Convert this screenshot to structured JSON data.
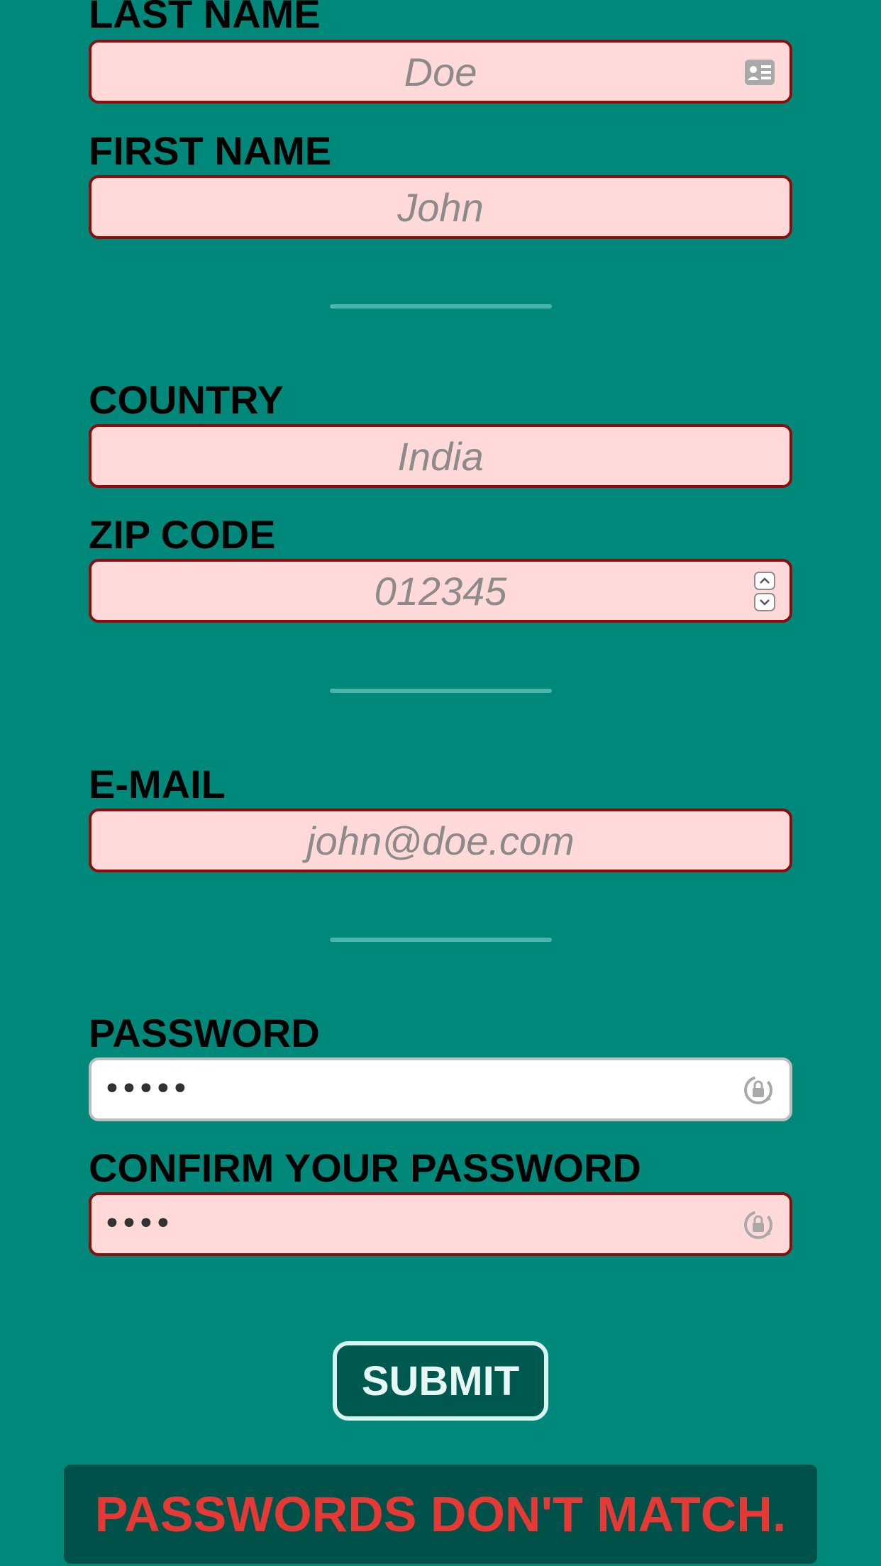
{
  "form": {
    "last_name": {
      "label": "LAST NAME",
      "placeholder": "Doe",
      "value": ""
    },
    "first_name": {
      "label": "FIRST NAME",
      "placeholder": "John",
      "value": ""
    },
    "country": {
      "label": "COUNTRY",
      "placeholder": "India",
      "value": ""
    },
    "zip": {
      "label": "ZIP CODE",
      "placeholder": "012345",
      "value": ""
    },
    "email": {
      "label": "E-MAIL",
      "placeholder": "john@doe.com",
      "value": ""
    },
    "password": {
      "label": "PASSWORD",
      "masked_value": "•••••"
    },
    "confirm_password": {
      "label": "CONFIRM YOUR PASSWORD",
      "masked_value": "••••"
    },
    "submit_label": "SUBMIT",
    "error_message": "PASSWORDS DON'T MATCH."
  },
  "icons": {
    "contact_card": "contact-card-icon",
    "stepper": "number-stepper-icon",
    "password_key": "password-key-icon"
  },
  "colors": {
    "background": "#00897b",
    "field_error_bg": "#ffdad9",
    "field_error_border": "#8b0d0d",
    "divider": "#4db6ac",
    "button_bg": "#00594f",
    "error_text": "#e53935",
    "error_box": "#005149"
  }
}
